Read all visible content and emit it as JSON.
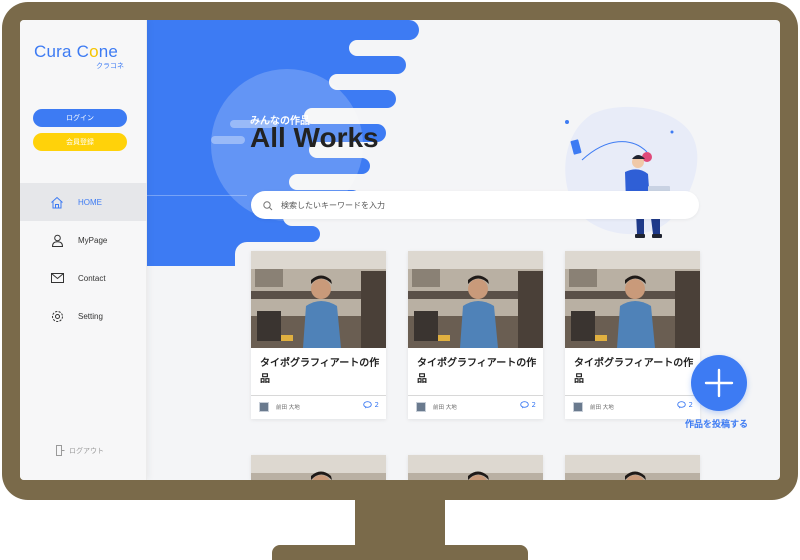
{
  "app": {
    "logo_text_before": "Cura C",
    "logo_text_o": "o",
    "logo_text_after": "ne",
    "logo_sub": "クラコネ",
    "brand_blue": "#3d7bf3",
    "brand_yellow": "#ffd20a"
  },
  "auth": {
    "login_label": "ログイン",
    "register_label": "会員登録"
  },
  "nav": {
    "items": [
      {
        "label": "HOME",
        "icon": "home-icon",
        "active": true
      },
      {
        "label": "MyPage",
        "icon": "user-icon",
        "active": false
      },
      {
        "label": "Contact",
        "icon": "mail-icon",
        "active": false
      },
      {
        "label": "Setting",
        "icon": "gear-icon",
        "active": false
      }
    ],
    "logout_label": "ログアウト"
  },
  "hero": {
    "subtitle": "みんなの作品",
    "title": "All Works"
  },
  "search": {
    "placeholder": "検索したいキーワードを入力",
    "value": ""
  },
  "works": {
    "cards": [
      {
        "title": "タイポグラフィアートの作品",
        "author": "前田 大地",
        "comments": "2"
      },
      {
        "title": "タイポグラフィアートの作品",
        "author": "前田 大地",
        "comments": "2"
      },
      {
        "title": "タイポグラフィアートの作品",
        "author": "前田 大地",
        "comments": "2"
      }
    ]
  },
  "fab": {
    "label": "作品を投稿する"
  }
}
